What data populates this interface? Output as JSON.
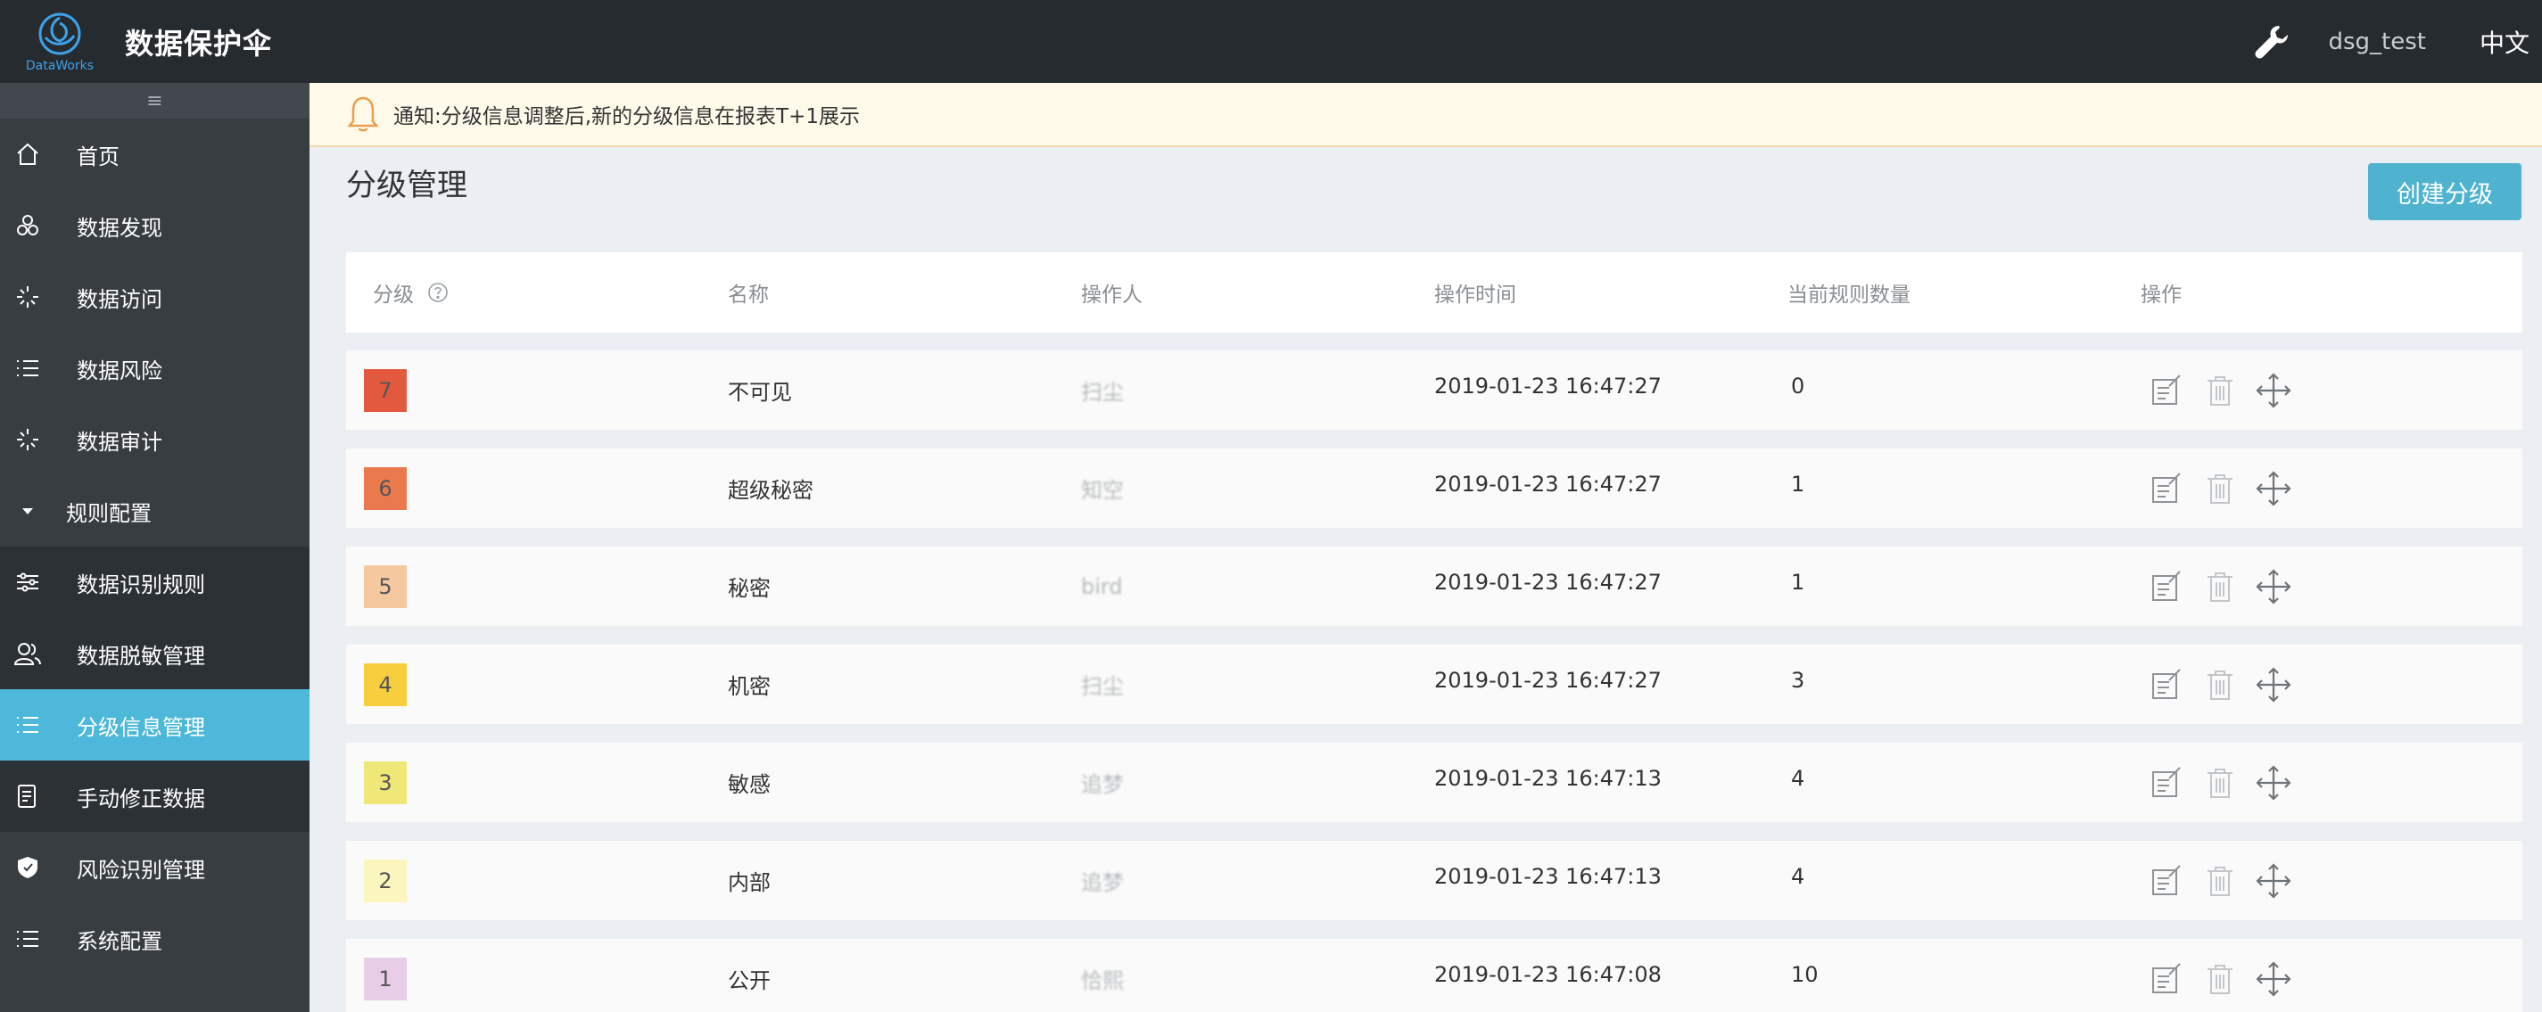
{
  "brand": {
    "title": "数据保护伞",
    "logo_text": "DataWorks"
  },
  "topbar": {
    "user": "dsg_test",
    "language": "中文"
  },
  "sidebar": {
    "collapse_glyph": "≡",
    "items": [
      {
        "label": "首页",
        "icon": "home-icon"
      },
      {
        "label": "数据发现",
        "icon": "discover-icon"
      },
      {
        "label": "数据访问",
        "icon": "access-icon"
      },
      {
        "label": "数据风险",
        "icon": "list-icon"
      },
      {
        "label": "数据审计",
        "icon": "audit-icon"
      }
    ],
    "group": {
      "label": "规则配置",
      "icon": "caret-down-icon"
    },
    "sub_items": [
      {
        "label": "数据识别规则",
        "icon": "sliders-icon"
      },
      {
        "label": "数据脱敏管理",
        "icon": "users-icon"
      },
      {
        "label": "分级信息管理",
        "icon": "list-icon",
        "active": true
      },
      {
        "label": "手动修正数据",
        "icon": "doc-edit-icon"
      }
    ],
    "bottom_items": [
      {
        "label": "风险识别管理",
        "icon": "shield-icon"
      },
      {
        "label": "系统配置",
        "icon": "list-icon"
      }
    ]
  },
  "notice": {
    "text": "通知:分级信息调整后,新的分级信息在报表T+1展示"
  },
  "page": {
    "title": "分级管理",
    "create_button": "创建分级"
  },
  "table": {
    "columns": [
      "分级",
      "名称",
      "操作人",
      "操作时间",
      "当前规则数量",
      "操作"
    ],
    "rows": [
      {
        "level": "7",
        "color": "#e2593f",
        "name": "不可见",
        "operator": "扫尘",
        "time": "2019-01-23 16:47:27",
        "count": "0"
      },
      {
        "level": "6",
        "color": "#ea7a4d",
        "name": "超级秘密",
        "operator": "知空",
        "time": "2019-01-23 16:47:27",
        "count": "1"
      },
      {
        "level": "5",
        "color": "#f4c9a0",
        "name": "秘密",
        "operator": "bird",
        "time": "2019-01-23 16:47:27",
        "count": "1"
      },
      {
        "level": "4",
        "color": "#f7cf3e",
        "name": "机密",
        "operator": "扫尘",
        "time": "2019-01-23 16:47:27",
        "count": "3"
      },
      {
        "level": "3",
        "color": "#efe777",
        "name": "敏感",
        "operator": "追梦",
        "time": "2019-01-23 16:47:13",
        "count": "4"
      },
      {
        "level": "2",
        "color": "#fbf6bd",
        "name": "内部",
        "operator": "追梦",
        "time": "2019-01-23 16:47:13",
        "count": "4"
      },
      {
        "level": "1",
        "color": "#e7cde6",
        "name": "公开",
        "operator": "恰熙",
        "time": "2019-01-23 16:47:08",
        "count": "10"
      }
    ]
  },
  "colors": {
    "accent": "#4db8d9",
    "sidebar_bg": "#373d41",
    "topbar_bg": "#262b2f"
  }
}
